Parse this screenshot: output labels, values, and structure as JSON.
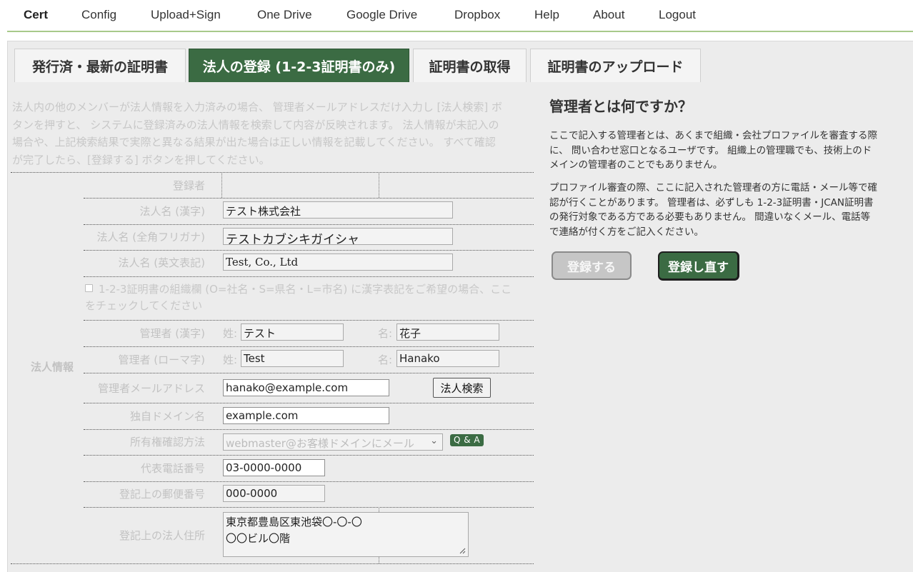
{
  "nav": {
    "brand": "Cert",
    "items": [
      "Config",
      "Upload+Sign",
      "One Drive",
      "Google Drive",
      "Dropbox",
      "Help",
      "About",
      "Logout"
    ]
  },
  "tabs": [
    "発行済・最新の証明書",
    "法人の登録 (1-2-3証明書のみ)",
    "証明書の取得",
    "証明書のアップロード"
  ],
  "intro": "法人内の他のメンバーが法人情報を入力済みの場合、 管理者メールアドレスだけ入力し [法人検索] ボタンを押すと、 システムに登録済みの法人情報を検索して内容が反映されます。 法人情報が未記入の場合や、上記検索結果で実際と異なる結果が出た場合は正しい情報を記載してください。 すべて確認が完了したら、[登録する] ボタンを押してください。",
  "form": {
    "section_registrant": "登録者",
    "section_company": "法人情報",
    "name_kanji_label": "法人名 (漢字)",
    "name_kanji_value": "テスト株式会社",
    "name_kana_label": "法人名 (全角フリガナ)",
    "name_kana_value": "テストカブシキガイシャ",
    "name_en_label": "法人名 (英文表記)",
    "name_en_value": "Test, Co., Ltd",
    "kanji_checkbox_text": "1-2-3証明書の組織欄 (O=社名・S=県名・L=市名) に漢字表記をご希望の場合、ここをチェックしてください",
    "admin_kanji_label": "管理者 (漢字)",
    "admin_kanji_last_prefix": "姓:",
    "admin_kanji_last": "テスト",
    "admin_kanji_first_prefix": "名:",
    "admin_kanji_first": "花子",
    "admin_roman_label": "管理者 (ローマ字)",
    "admin_roman_last_prefix": "姓:",
    "admin_roman_last": "Test",
    "admin_roman_first_prefix": "名:",
    "admin_roman_first": "Hanako",
    "admin_email_label": "管理者メールアドレス",
    "admin_email_value": "hanako@example.com",
    "search_button": "法人検索",
    "domain_label": "独自ドメイン名",
    "domain_value": "example.com",
    "verify_label": "所有権確認方法",
    "verify_selected": "webmaster@お客様ドメインにメール",
    "qa_badge": "Q & A",
    "phone_label": "代表電話番号",
    "phone_value": "03-0000-0000",
    "zip_label": "登記上の郵便番号",
    "zip_value": "000-0000",
    "address_label": "登記上の法人住所",
    "address_line1": "東京都豊島区東池袋〇-〇-〇",
    "address_line2": "〇〇ビル〇階"
  },
  "help": {
    "title": "管理者とは何ですか？",
    "para1": "ここで記入する管理者とは、あくまで組織・会社プロファイルを審査する際に、 問い合わせ窓口となるユーザです。 組織上の管理職でも、技術上のドメインの管理者のことでもありません。",
    "para2": "プロファイル審査の際、ここに記入された管理者の方に電話・メール等で確認が行くことがあります。 管理者は、必ずしも 1-2-3証明書・JCAN証明書の発行対象である方である必要もありません。 間違いなくメール、電話等で連絡が付く方をご記入ください。",
    "register_button": "登録する",
    "reregister_button": "登録し直す"
  },
  "colors": {
    "accent_green": "#3b6b43",
    "nav_rule": "#a8c98a",
    "panel_bg": "#ececec"
  }
}
